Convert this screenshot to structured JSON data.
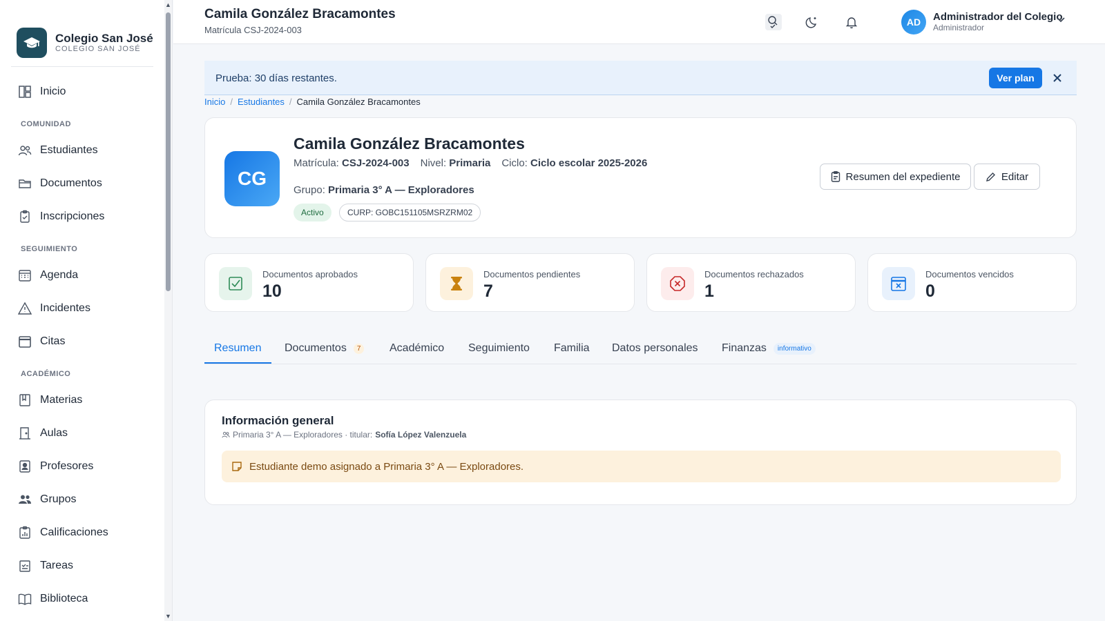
{
  "app": {
    "brand_name": "Colegio San José",
    "brand_sub": "COLEGIO SAN JOSÉ"
  },
  "sidebar": {
    "home": "Inicio",
    "sections": {
      "comunidad": "COMUNIDAD",
      "seguimiento": "SEGUIMIENTO",
      "academico": "ACADÉMICO"
    },
    "items": [
      {
        "label": "Estudiantes",
        "icon": "users-icon"
      },
      {
        "label": "Documentos",
        "icon": "folder-icon"
      },
      {
        "label": "Inscripciones",
        "icon": "clipboard-icon"
      },
      {
        "label": "Agenda",
        "icon": "calendar-icon"
      },
      {
        "label": "Incidentes",
        "icon": "warning-icon"
      },
      {
        "label": "Citas",
        "icon": "calendar-event-icon"
      },
      {
        "label": "Materias",
        "icon": "book-open-icon"
      },
      {
        "label": "Aulas",
        "icon": "door-icon"
      },
      {
        "label": "Profesores",
        "icon": "badge-icon"
      },
      {
        "label": "Grupos",
        "icon": "people-icon"
      },
      {
        "label": "Calificaciones",
        "icon": "chart-icon"
      },
      {
        "label": "Tareas",
        "icon": "task-icon"
      },
      {
        "label": "Biblioteca",
        "icon": "library-icon"
      }
    ]
  },
  "header": {
    "title": "Camila González Bracamontes",
    "subtitle": "Matrícula CSJ-2024-003",
    "user_initials": "AD",
    "user_name": "Administrador del Colegio",
    "user_role": "Administrador"
  },
  "trial": {
    "text": "Prueba: 30 días restantes.",
    "button": "Ver plan"
  },
  "breadcrumb": {
    "home": "Inicio",
    "section": "Estudiantes",
    "current": "Camila González Bracamontes"
  },
  "student": {
    "initials": "CG",
    "name": "Camila González Bracamontes",
    "matricula_label": "Matrícula:",
    "matricula": "CSJ-2024-003",
    "nivel_label": "Nivel:",
    "nivel": "Primaria",
    "ciclo_label": "Ciclo:",
    "ciclo": "Ciclo escolar 2025-2026",
    "grupo_label": "Grupo:",
    "grupo": "Primaria 3° A — Exploradores",
    "status": "Activo",
    "curp": "CURP: GOBC151105MSRZRM02",
    "btn_resumen": "Resumen del expediente",
    "btn_editar": "Editar"
  },
  "stats": [
    {
      "label": "Documentos aprobados",
      "value": "10",
      "icon": "check-square-icon",
      "color": "#2e8b57",
      "bg": "#e6f4ec"
    },
    {
      "label": "Documentos pendientes",
      "value": "7",
      "icon": "hourglass-icon",
      "color": "#c9820f",
      "bg": "#fdf1dd"
    },
    {
      "label": "Documentos rechazados",
      "value": "1",
      "icon": "x-octagon-icon",
      "color": "#c62828",
      "bg": "#fdecec"
    },
    {
      "label": "Documentos vencidos",
      "value": "0",
      "icon": "calendar-x-icon",
      "color": "#1677e5",
      "bg": "#e8f1fc"
    }
  ],
  "tabs": {
    "resumen": "Resumen",
    "documentos": "Documentos",
    "documentos_count": "7",
    "academico": "Académico",
    "seguimiento": "Seguimiento",
    "familia": "Familia",
    "datos": "Datos personales",
    "finanzas": "Finanzas",
    "finanzas_badge": "informativo"
  },
  "info": {
    "title": "Información general",
    "sub_prefix": "Primaria 3° A — Exploradores · titular:",
    "titular": "Sofía López Valenzuela",
    "note": "Estudiante demo asignado a Primaria 3° A — Exploradores."
  },
  "colors": {
    "accent": "#1677e5",
    "brand": "#1f4e5f"
  }
}
